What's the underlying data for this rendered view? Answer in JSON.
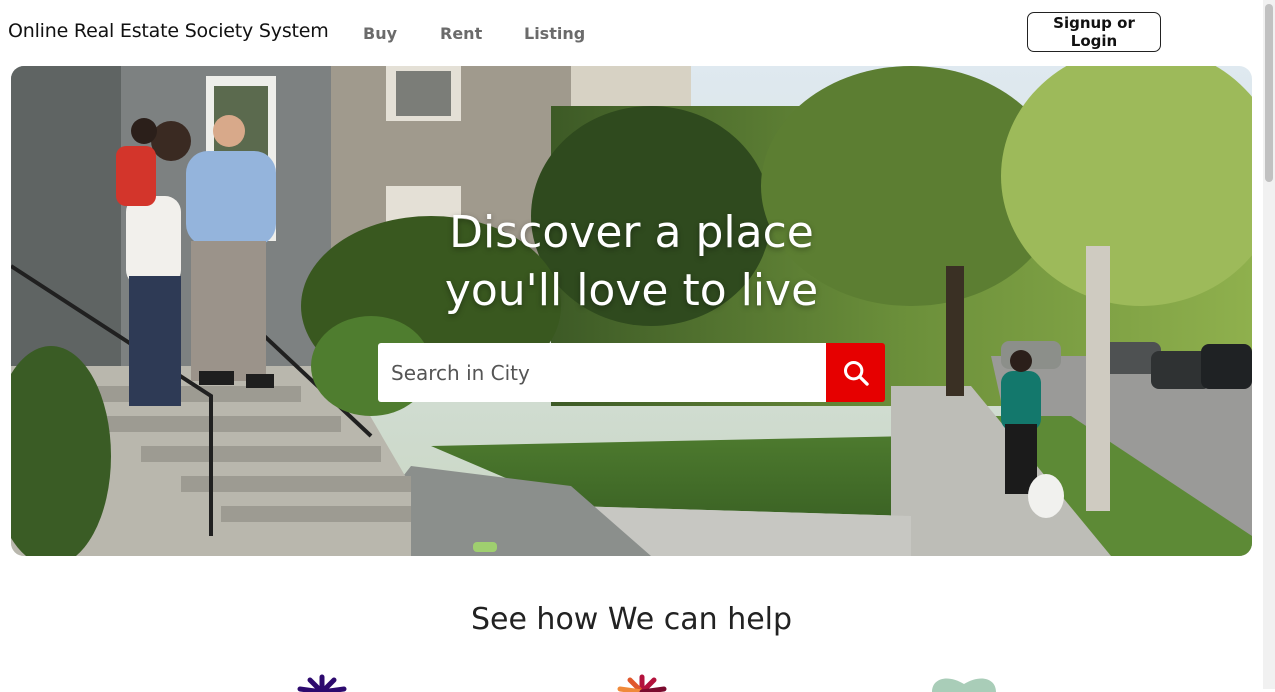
{
  "header": {
    "brand": "Online Real Estate Society System",
    "nav": {
      "buy": "Buy",
      "rent": "Rent",
      "listing": "Listing"
    },
    "auth_label": "Signup or Login"
  },
  "hero": {
    "title_line1": "Discover a place",
    "title_line2": "you'll love to live",
    "search": {
      "placeholder": "Search in City",
      "value": ""
    },
    "search_icon": "search-icon"
  },
  "help_section": {
    "title": "See how We can help",
    "icons": [
      "burst-icon-purple",
      "burst-icon-red",
      "heart-icon-green"
    ]
  },
  "colors": {
    "accent": "#e60000",
    "nav_text": "#6b6b6b",
    "heading": "#222222"
  }
}
